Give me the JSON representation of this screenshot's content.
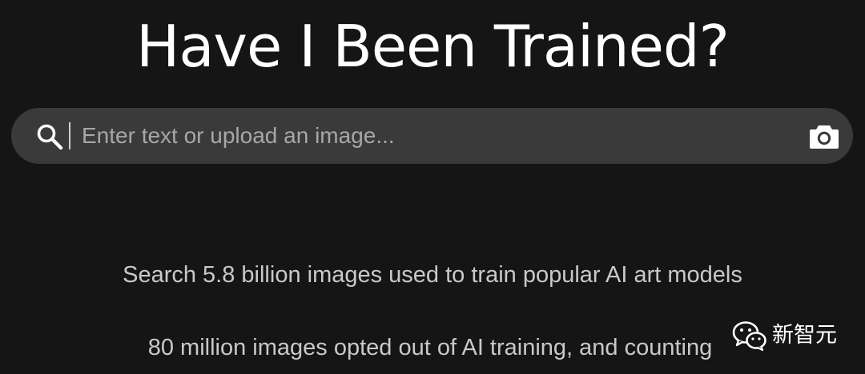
{
  "header": {
    "title": "Have I Been Trained?"
  },
  "search": {
    "placeholder": "Enter text or upload an image...",
    "value": "",
    "search_icon": "search-icon",
    "upload_icon": "camera-icon"
  },
  "info": {
    "line1": "Search 5.8 billion images used to train popular AI art models",
    "line2": "80 million images opted out of AI training, and counting"
  },
  "watermark": {
    "icon": "wechat-icon",
    "label": "新智元"
  },
  "colors": {
    "background": "#151515",
    "search_bar": "#3a3a3a",
    "title": "#ffffff",
    "info_text": "#c9c9c9",
    "placeholder": "#a7a7a7"
  }
}
